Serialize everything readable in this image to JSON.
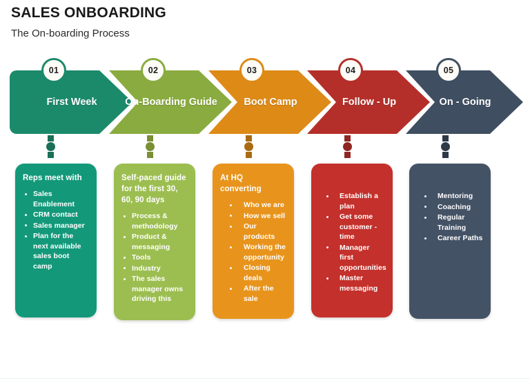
{
  "header": {
    "title": "SALES ONBOARDING",
    "subtitle": "The On-boarding Process"
  },
  "colors": {
    "teal": "#13997a",
    "olive": "#9cbe50",
    "orange": "#e8941c",
    "red": "#c4302b",
    "navy": "#445266",
    "arrow_teal": "#1b8a6b",
    "arrow_olive": "#8aab3f",
    "arrow_orange": "#dd8a17",
    "arrow_red": "#b52f2a",
    "arrow_navy": "#3f4e61",
    "badge_fill": "#fdfcf7",
    "heading_text": "#ffffff"
  },
  "steps": [
    {
      "number": "01",
      "arrow_label": "First Week",
      "arrow_color": "#1b8a6b",
      "card_color": "#13997a",
      "connector_color": "#1b6f58",
      "card_heading": "Reps meet with",
      "bullets": [
        "Sales Enablement",
        "CRM contact",
        "Sales manager",
        "Plan for the next available sales boot camp"
      ]
    },
    {
      "number": "02",
      "arrow_label": "On-Boarding Guide",
      "arrow_color": "#8aab3f",
      "card_color": "#9cbe50",
      "connector_color": "#7b8f34",
      "card_heading": "Self-paced guide for the first 30, 60, 90 days",
      "bullets": [
        "Process & methodology",
        "Product & messaging",
        "Tools",
        "Industry",
        "The sales manager owns driving this"
      ]
    },
    {
      "number": "03",
      "arrow_label": "Boot Camp",
      "arrow_color": "#dd8a17",
      "card_color": "#e8941c",
      "connector_color": "#aa6a12",
      "card_heading": "At HQ converting",
      "bullets": [
        "Who we are",
        "How we sell",
        "Our products",
        "Working the opportunity",
        "Closing deals",
        "After the sale"
      ]
    },
    {
      "number": "04",
      "arrow_label": "Follow - Up",
      "arrow_color": "#b52f2a",
      "card_color": "#c4302b",
      "connector_color": "#8f2622",
      "card_heading": "",
      "bullets": [
        "Establish a plan",
        "Get some customer - time",
        "Manager first opportunities",
        "Master messaging"
      ]
    },
    {
      "number": "05",
      "arrow_label": "On - Going",
      "arrow_color": "#3f4e61",
      "card_color": "#445266",
      "connector_color": "#2e3947",
      "card_heading": "",
      "bullets": [
        "Mentoring",
        "Coaching",
        "Regular Training",
        "Career  Paths"
      ]
    }
  ]
}
